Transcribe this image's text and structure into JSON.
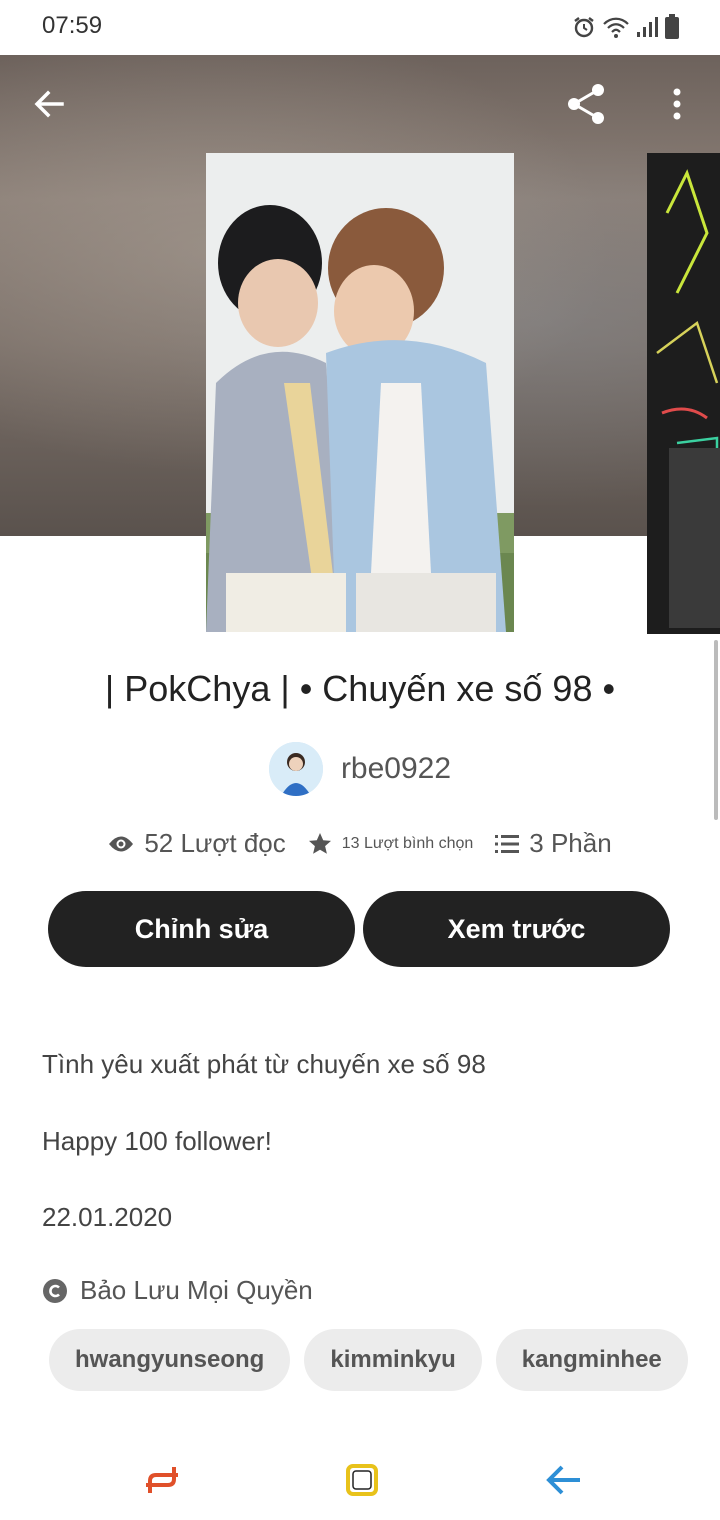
{
  "status": {
    "time": "07:59"
  },
  "book": {
    "title": "| PokChya | • Chuyến xe số 98 •",
    "author": "rbe0922",
    "stats": {
      "reads": "52 Lượt đọc",
      "votes": "13 Lượt bình chọn",
      "parts": "3 Phần"
    }
  },
  "actions": {
    "edit_label": "Chỉnh sửa",
    "preview_label": "Xem trước"
  },
  "description": {
    "line1": "Tình yêu xuất phát từ chuyến xe số 98",
    "line2": "Happy 100 follower!",
    "line3": "22.01.2020"
  },
  "copyright": "Bảo Lưu Mọi Quyền",
  "tags": [
    "hwangyunseong",
    "kimminkyu",
    "kangminhee"
  ],
  "icons": {
    "back": "arrow-left-icon",
    "share": "share-icon",
    "menu": "more-vertical-icon",
    "reads": "eye-icon",
    "votes": "star-icon",
    "parts": "list-icon",
    "copyright": "copyright-icon"
  },
  "colors": {
    "button": "#222222",
    "tag_bg": "#ececec",
    "nav_recent": "#e0502a",
    "nav_home": "#e8c21a",
    "nav_back": "#2d8fd6"
  }
}
